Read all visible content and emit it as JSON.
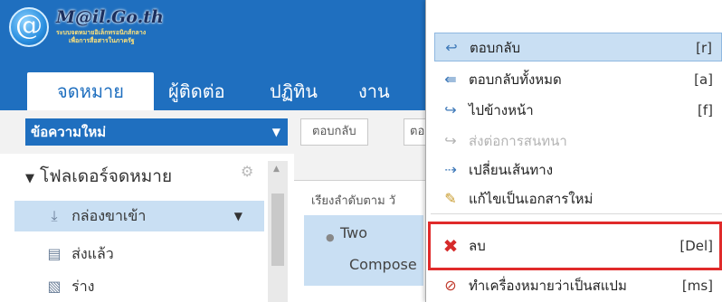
{
  "logo": {
    "title": "M@il.Go.th",
    "subtitle_line1": "ระบบจดหมายอิเล็กทรอนิกส์กลาง",
    "subtitle_line2": "เพื่อการสื่อสารในภาครัฐ",
    "icon": "at-sign-logo-icon"
  },
  "tabs": [
    {
      "label": "จดหมาย",
      "active": true
    },
    {
      "label": "ผู้ติดต่อ",
      "active": false
    },
    {
      "label": "ปฏิทิน",
      "active": false
    },
    {
      "label": "งาน",
      "active": false
    }
  ],
  "toolbar": {
    "new_message": "ข้อความใหม่",
    "reply": "ตอบกลับ",
    "reply_cut": "ตอ"
  },
  "folders": {
    "title": "โฟลเดอร์จดหมาย",
    "items": [
      {
        "label": "กล่องขาเข้า",
        "icon": "inbox-icon",
        "selected": true
      },
      {
        "label": "ส่งแล้ว",
        "icon": "sent-folder-icon",
        "selected": false
      },
      {
        "label": "ร่าง",
        "icon": "drafts-folder-icon",
        "selected": false
      }
    ]
  },
  "list": {
    "sort_label": "เรียงลำดับตาม วั",
    "row_sender": "Two",
    "row_subject": "Compose"
  },
  "menu": {
    "items": [
      {
        "label": "ตอบกลับ",
        "shortcut": "[r]",
        "icon": "reply-icon",
        "highlighted": true,
        "disabled": false
      },
      {
        "label": "ตอบกลับทั้งหมด",
        "shortcut": "[a]",
        "icon": "reply-all-icon",
        "highlighted": false,
        "disabled": false
      },
      {
        "label": "ไปข้างหน้า",
        "shortcut": "[f]",
        "icon": "forward-icon",
        "highlighted": false,
        "disabled": false
      },
      {
        "label": "ส่งต่อการสนทนา",
        "shortcut": "",
        "icon": "forward-conversation-icon",
        "highlighted": false,
        "disabled": true
      },
      {
        "label": "เปลี่ยนเส้นทาง",
        "shortcut": "",
        "icon": "redirect-icon",
        "highlighted": false,
        "disabled": false
      },
      {
        "label": "แก้ไขเป็นเอกสารใหม่",
        "shortcut": "",
        "icon": "pencil-icon",
        "highlighted": false,
        "disabled": false
      },
      {
        "label": "ลบ",
        "shortcut": "[Del]",
        "icon": "delete-x-icon",
        "highlighted": false,
        "disabled": false
      },
      {
        "label": "ทำเครื่องหมายว่าเป็นสแปม",
        "shortcut": "[ms]",
        "icon": "spam-icon",
        "highlighted": false,
        "disabled": false
      }
    ]
  },
  "colors": {
    "brand_blue": "#1f6fbf",
    "selection": "#c9dff3",
    "delete_red": "#e02a2a"
  }
}
